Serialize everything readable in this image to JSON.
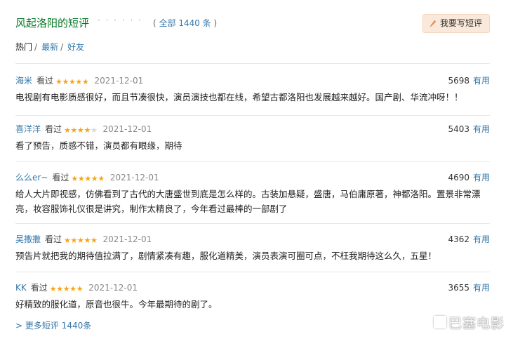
{
  "header": {
    "title": "风起洛阳的短评",
    "dots": "· · · · · ·",
    "count_prefix": "( ",
    "count_link": "全部 1440 条",
    "count_suffix": " )",
    "write_button": "我要写短评"
  },
  "filters": [
    {
      "label": "热门",
      "sep": "/"
    },
    {
      "label": "最新",
      "sep": "/"
    },
    {
      "label": "好友",
      "sep": ""
    }
  ],
  "reviews": [
    {
      "user": "海米",
      "status": "看过",
      "rating": 5,
      "date": "2021-12-01",
      "votes": "5698",
      "useful": "有用",
      "content": "电视剧有电影质感很好，而且节凑很快，演员演技也都在线，希望古都洛阳也发展越来越好。国产剧、华流冲呀！！"
    },
    {
      "user": "喜洋洋",
      "status": "看过",
      "rating": 4,
      "date": "2021-12-01",
      "votes": "5403",
      "useful": "有用",
      "content": "看了预告，质感不错，演员都有眼缘，期待"
    },
    {
      "user": "么么er~",
      "status": "看过",
      "rating": 5,
      "date": "2021-12-01",
      "votes": "4690",
      "useful": "有用",
      "content": "给人大片即视感，仿佛看到了古代的大唐盛世到底是怎么样的。古装加悬疑，盛唐，马伯庸原著，神都洛阳。置景非常漂亮，妆容服饰礼仪很是讲究，制作太精良了，今年看过最棒的一部剧了"
    },
    {
      "user": "吴撒撒",
      "status": "看过",
      "rating": 5,
      "date": "2021-12-01",
      "votes": "4362",
      "useful": "有用",
      "content": "预告片就把我的期待值拉满了，剧情紧凑有趣，服化道精美，演员表演可圈可点，不枉我期待这么久，五星！"
    },
    {
      "user": "KK",
      "status": "看过",
      "rating": 5,
      "date": "2021-12-01",
      "votes": "3655",
      "useful": "有用",
      "content": "好精致的服化道，原音也很牛。今年最期待的剧了。"
    }
  ],
  "more_link": "> 更多短评 1440条",
  "watermark": "巴塞电影",
  "colors": {
    "title": "#007722",
    "link": "#37a",
    "star": "#f6a519",
    "button_bg": "#fae9da"
  }
}
